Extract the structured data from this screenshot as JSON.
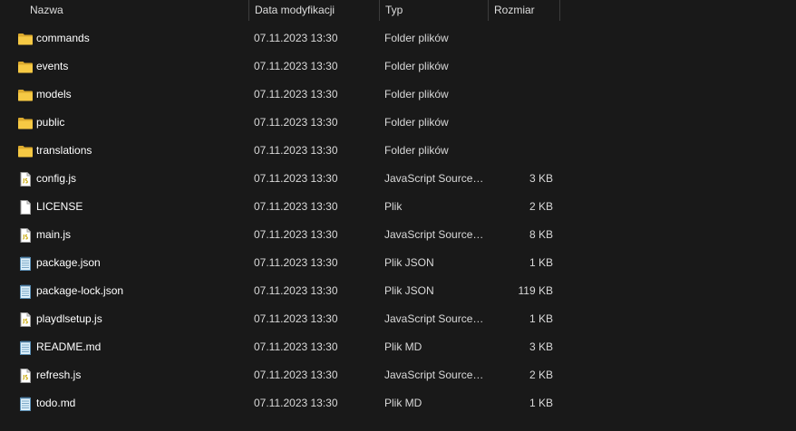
{
  "columns": {
    "name": "Nazwa",
    "date": "Data modyfikacji",
    "type": "Typ",
    "size": "Rozmiar"
  },
  "sort_indicator": "^",
  "files": [
    {
      "name": "commands",
      "date": "07.11.2023 13:30",
      "type": "Folder plików",
      "size": "",
      "icon": "folder-icon"
    },
    {
      "name": "events",
      "date": "07.11.2023 13:30",
      "type": "Folder plików",
      "size": "",
      "icon": "folder-icon"
    },
    {
      "name": "models",
      "date": "07.11.2023 13:30",
      "type": "Folder plików",
      "size": "",
      "icon": "folder-icon"
    },
    {
      "name": "public",
      "date": "07.11.2023 13:30",
      "type": "Folder plików",
      "size": "",
      "icon": "folder-icon"
    },
    {
      "name": "translations",
      "date": "07.11.2023 13:30",
      "type": "Folder plików",
      "size": "",
      "icon": "folder-icon"
    },
    {
      "name": "config.js",
      "date": "07.11.2023 13:30",
      "type": "JavaScript Source ...",
      "size": "3 KB",
      "icon": "js-file-icon"
    },
    {
      "name": "LICENSE",
      "date": "07.11.2023 13:30",
      "type": "Plik",
      "size": "2 KB",
      "icon": "file-icon"
    },
    {
      "name": "main.js",
      "date": "07.11.2023 13:30",
      "type": "JavaScript Source ...",
      "size": "8 KB",
      "icon": "js-file-icon"
    },
    {
      "name": "package.json",
      "date": "07.11.2023 13:30",
      "type": "Plik JSON",
      "size": "1 KB",
      "icon": "notepad-file-icon"
    },
    {
      "name": "package-lock.json",
      "date": "07.11.2023 13:30",
      "type": "Plik JSON",
      "size": "119 KB",
      "icon": "notepad-file-icon"
    },
    {
      "name": "playdlsetup.js",
      "date": "07.11.2023 13:30",
      "type": "JavaScript Source ...",
      "size": "1 KB",
      "icon": "js-file-icon"
    },
    {
      "name": "README.md",
      "date": "07.11.2023 13:30",
      "type": "Plik MD",
      "size": "3 KB",
      "icon": "notepad-file-icon"
    },
    {
      "name": "refresh.js",
      "date": "07.11.2023 13:30",
      "type": "JavaScript Source ...",
      "size": "2 KB",
      "icon": "js-file-icon"
    },
    {
      "name": "todo.md",
      "date": "07.11.2023 13:30",
      "type": "Plik MD",
      "size": "1 KB",
      "icon": "notepad-file-icon"
    }
  ],
  "colors": {
    "background": "#191919",
    "text": "#ffffff",
    "folder": "#f6c944",
    "column_divider": "#3c3c3c"
  }
}
